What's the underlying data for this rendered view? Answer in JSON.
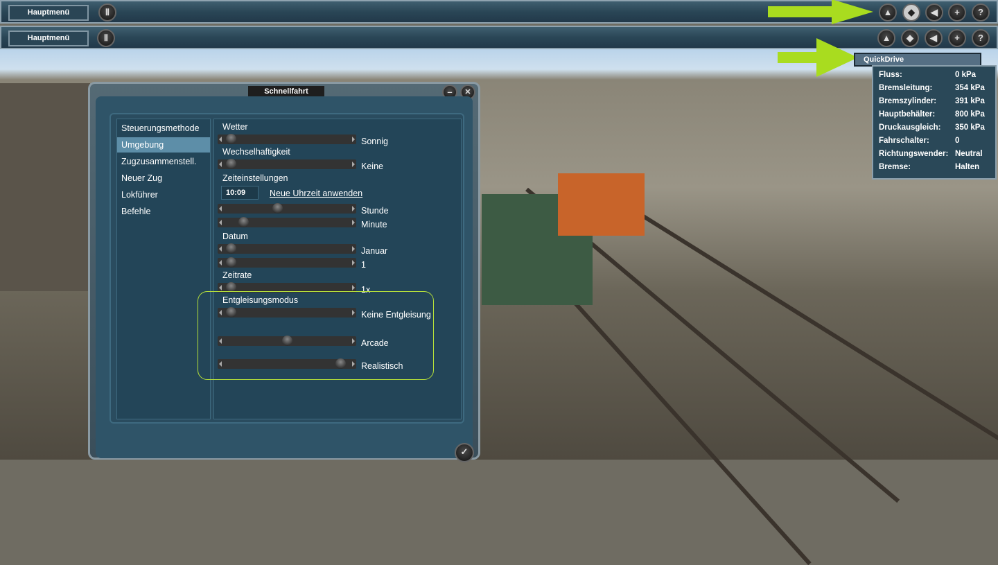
{
  "toolbar": [
    {
      "menu_label": "Hauptmenü"
    },
    {
      "menu_label": "Hauptmenü"
    }
  ],
  "toolbar_icons": {
    "pause": "Ⅱ",
    "mountain": "▲",
    "eraser": "◆",
    "sound": "◀",
    "plus": "+",
    "help": "?"
  },
  "dropdown": {
    "item": "QuickDrive"
  },
  "info_panel": [
    {
      "key": "Fluss:",
      "value": "0 kPa"
    },
    {
      "key": "Bremsleitung:",
      "value": "354 kPa"
    },
    {
      "key": "Bremszylinder:",
      "value": "391 kPa"
    },
    {
      "key": "Hauptbehälter:",
      "value": "800 kPa"
    },
    {
      "key": "Druckausgleich:",
      "value": "350 kPa"
    },
    {
      "key": "Fahrschalter:",
      "value": "0"
    },
    {
      "key": "Richtungswender:",
      "value": "Neutral"
    },
    {
      "key": "Bremse:",
      "value": "Halten"
    }
  ],
  "dialog": {
    "title": "Schnellfahrt",
    "minimize": "–",
    "close": "✕",
    "ok": "✓",
    "sidebar": [
      "Steuerungsmethode",
      "Umgebung",
      "Zugzusammenstell.",
      "Neuer Zug",
      "Lokführer",
      "Befehle"
    ],
    "selected": 1,
    "labels": {
      "wetter": "Wetter",
      "wechsel": "Wechselhaftigkeit",
      "zeit": "Zeiteinstellungen",
      "datum": "Datum",
      "zeitrate": "Zeitrate",
      "entgleisung": "Entgleisungsmodus"
    },
    "time_value": "10:09",
    "apply_time": "Neue Uhrzeit anwenden",
    "sliders": [
      {
        "value_label": "Sonnig",
        "position": 0.05
      },
      {
        "value_label": "Keine",
        "position": 0.05
      },
      {
        "value_label": "Stunde",
        "position": 0.42
      },
      {
        "value_label": "Minute",
        "position": 0.15
      },
      {
        "value_label": "Januar",
        "position": 0.05
      },
      {
        "value_label": "1",
        "position": 0.05
      },
      {
        "value_label": "1x",
        "position": 0.05
      },
      {
        "value_label": "Keine Entgleisung",
        "position": 0.05
      },
      {
        "value_label": "Arcade",
        "position": 0.5
      },
      {
        "value_label": "Realistisch",
        "position": 0.93
      }
    ]
  }
}
